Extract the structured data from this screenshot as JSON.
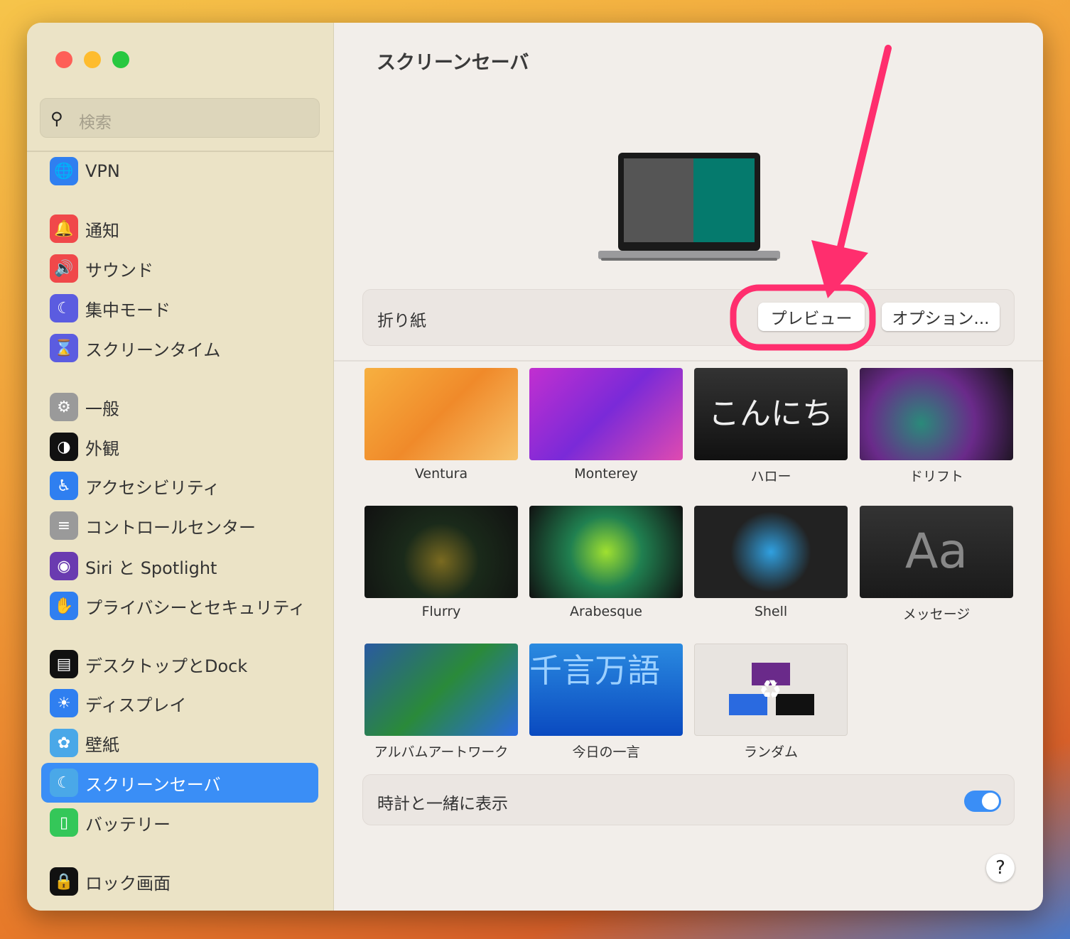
{
  "sidebar": {
    "search_placeholder": "検索",
    "items": [
      {
        "label": "VPN",
        "icon": "globe-shield-icon",
        "color": "#2f7ff0"
      },
      {
        "label": "通知",
        "icon": "bell-icon",
        "color": "#f0484a"
      },
      {
        "label": "サウンド",
        "icon": "speaker-icon",
        "color": "#f0484a"
      },
      {
        "label": "集中モード",
        "icon": "moon-icon",
        "color": "#5b5ce0"
      },
      {
        "label": "スクリーンタイム",
        "icon": "hourglass-icon",
        "color": "#5b5ce0"
      },
      {
        "label": "一般",
        "icon": "gear-icon",
        "color": "#9a9a9a"
      },
      {
        "label": "外観",
        "icon": "appearance-icon",
        "color": "#111111"
      },
      {
        "label": "アクセシビリティ",
        "icon": "accessibility-icon",
        "color": "#2f7ff0"
      },
      {
        "label": "コントロールセンター",
        "icon": "toggles-icon",
        "color": "#9a9a9a"
      },
      {
        "label": "Siri と Spotlight",
        "icon": "siri-icon",
        "color": "#6a3bb0"
      },
      {
        "label": "プライバシーとセキュリティ",
        "icon": "hand-icon",
        "color": "#2f7ff0"
      },
      {
        "label": "デスクトップとDock",
        "icon": "dock-icon",
        "color": "#111111"
      },
      {
        "label": "ディスプレイ",
        "icon": "sun-icon",
        "color": "#2f7ff0"
      },
      {
        "label": "壁紙",
        "icon": "flower-icon",
        "color": "#4aa8e8"
      },
      {
        "label": "スクリーンセーバ",
        "icon": "screensaver-icon",
        "color": "#4aa8e8",
        "selected": true
      },
      {
        "label": "バッテリー",
        "icon": "battery-icon",
        "color": "#34c759"
      },
      {
        "label": "ロック画面",
        "icon": "lock-icon",
        "color": "#111111"
      }
    ]
  },
  "main": {
    "title": "スクリーンセーバ",
    "current_saver": "折り紙",
    "preview_label": "プレビュー",
    "options_label": "オプション...",
    "savers": [
      "Ventura",
      "Monterey",
      "ハロー",
      "ドリフト",
      "Flurry",
      "Arabesque",
      "Shell",
      "メッセージ",
      "アルバムアートワーク",
      "今日の一言",
      "ランダム"
    ],
    "hello_text": "こんにちは",
    "message_text": "Aa",
    "word_text": "千言万語",
    "show_clock_label": "時計と一緒に表示",
    "show_clock_on": true,
    "help_label": "?"
  },
  "annotation_color": "#ff2e6e"
}
